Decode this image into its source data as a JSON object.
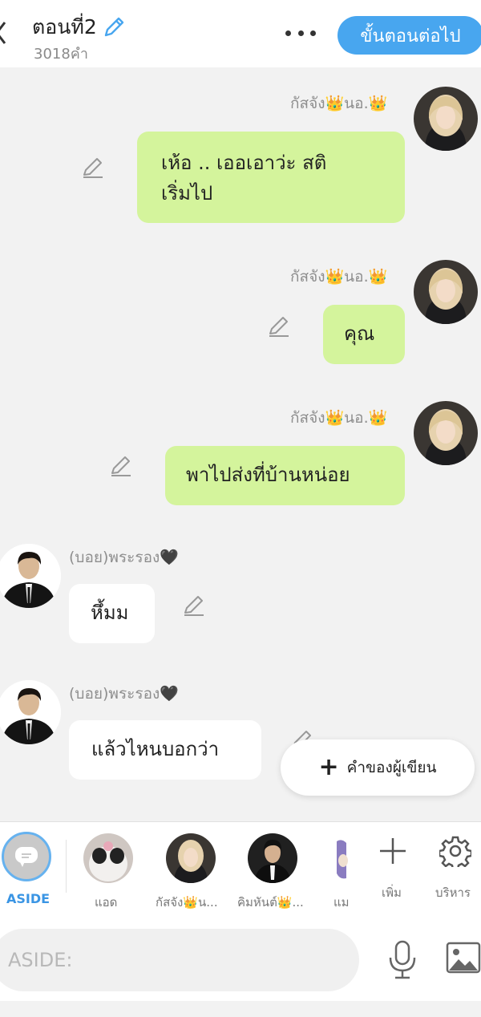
{
  "header": {
    "title": "ตอนที่2",
    "word_count": "3018คำ",
    "next_label": "ขั้นตอนต่อไป"
  },
  "messages": [
    {
      "sender": "กัสจัง👑นอ.👑",
      "text": "เห้อ .. เออเอาว่ะ  สติ\nเริ่มไป",
      "side": "right"
    },
    {
      "sender": "กัสจัง👑นอ.👑",
      "text": "คุณ",
      "side": "right"
    },
    {
      "sender": "กัสจัง👑นอ.👑",
      "text": "พาไปส่งที่บ้านหน่อย",
      "side": "right"
    },
    {
      "sender": "(บอย)พระรอง🖤",
      "text": "หึ้มม",
      "side": "left"
    },
    {
      "sender": "(บอย)พระรอง🖤",
      "text": "แล้วไหนบอกว่า",
      "side": "left"
    }
  ],
  "add_note_label": "คำของผู้เขียน",
  "charbar": {
    "aside_label": "ASIDE",
    "characters": [
      {
        "name": "แอด"
      },
      {
        "name": "กัสจัง👑น..."
      },
      {
        "name": "คิมหันต์👑..."
      },
      {
        "name": "แม"
      }
    ],
    "add_label": "เพิ่ม",
    "manage_label": "บริหาร"
  },
  "input": {
    "placeholder": "ASIDE:"
  },
  "colors": {
    "accent": "#48a6ef",
    "bubble_green": "#d4f49c",
    "aside_blue": "#3a95e4"
  }
}
